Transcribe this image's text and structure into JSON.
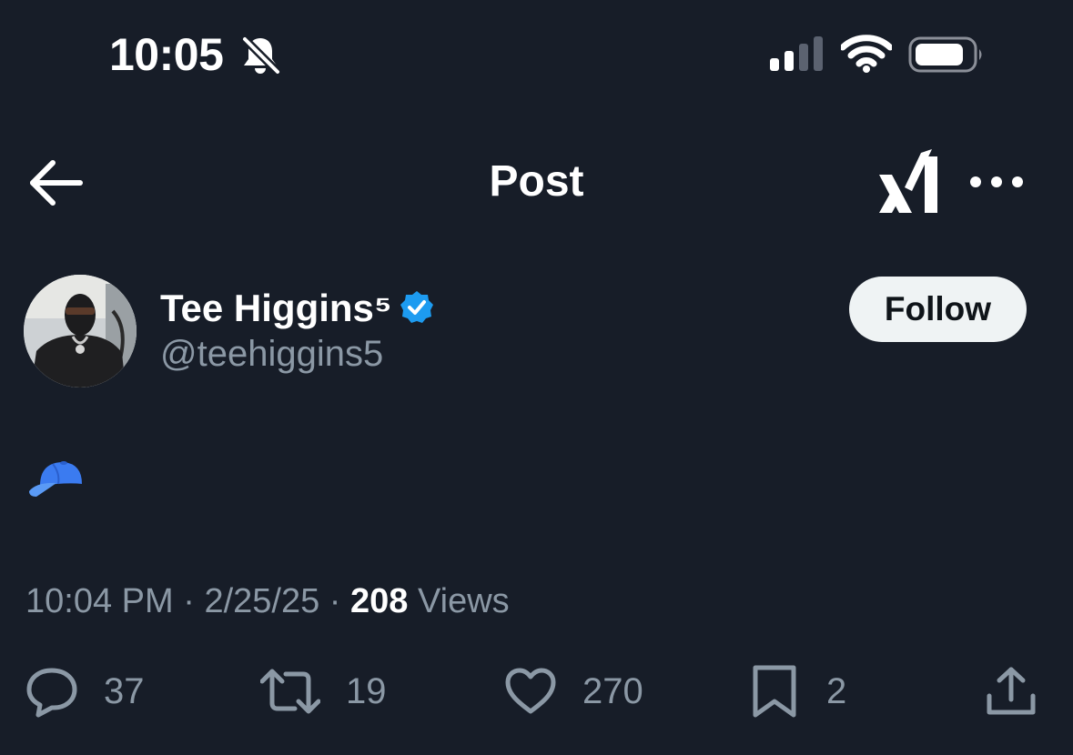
{
  "status_bar": {
    "time": "10:05",
    "icons": [
      "bell-slash-icon",
      "cellular-signal-icon",
      "wifi-icon",
      "battery-icon"
    ]
  },
  "header": {
    "title": "Post",
    "icons": [
      "back-arrow-icon",
      "grok-icon",
      "more-icon"
    ]
  },
  "author": {
    "name": "Tee Higgins⁵",
    "handle": "@teehiggins5",
    "verified": true,
    "follow_label": "Follow"
  },
  "post": {
    "content_emoji": "blue-cap-emoji",
    "time": "10:04 PM",
    "separator": "·",
    "date": "2/25/25",
    "views_count": "208",
    "views_label": "Views"
  },
  "actions": {
    "replies": "37",
    "reposts": "19",
    "likes": "270",
    "bookmarks": "2"
  },
  "colors": {
    "background": "#171d28",
    "text_primary": "#ffffff",
    "text_secondary": "#8b98a5",
    "verified_blue": "#1d9bf0",
    "follow_bg": "#eff3f4"
  }
}
